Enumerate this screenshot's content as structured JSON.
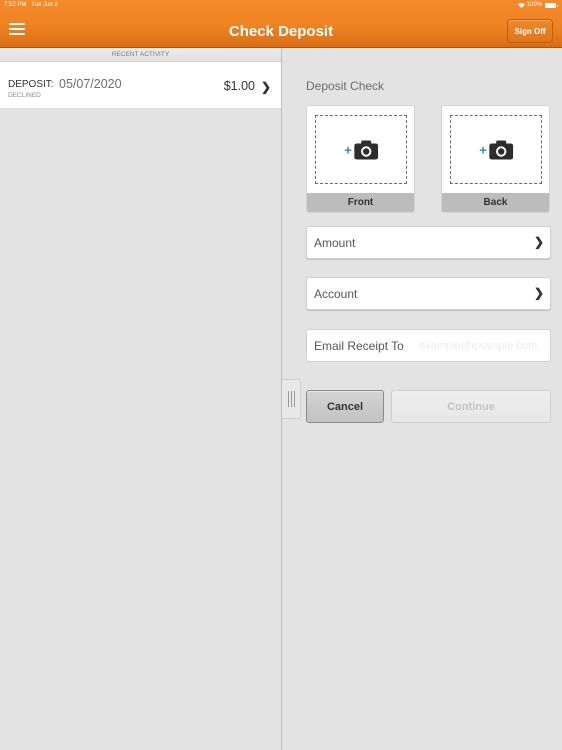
{
  "status_bar": {
    "time": "7:52 PM",
    "date": "Tue Jun 2",
    "battery": "100%",
    "wifi_icon": "wifi-icon",
    "battery_icon": "battery-icon"
  },
  "header": {
    "title": "Check Deposit",
    "menu_icon": "hamburger-menu-icon",
    "sign_off_label": "Sign Off",
    "brand_color": "#ef8322"
  },
  "recent_activity": {
    "header": "RECENT ACTIVITY",
    "items": [
      {
        "type": "DEPOSIT:",
        "date": "05/07/2020",
        "status": "DECLINED",
        "amount": "$1.00",
        "chevron_icon": "chevron-right-icon"
      }
    ]
  },
  "deposit_form": {
    "section_label": "Deposit Check",
    "captures": [
      {
        "label": "Front",
        "icon": "add-camera-icon"
      },
      {
        "label": "Back",
        "icon": "add-camera-icon"
      }
    ],
    "amount_label": "Amount",
    "account_label": "Account",
    "email_label": "Email Receipt To",
    "email_placeholder": "example@example.com",
    "email_value": "",
    "cancel_label": "Cancel",
    "continue_label": "Continue",
    "accent_color": "#2a86d4"
  }
}
